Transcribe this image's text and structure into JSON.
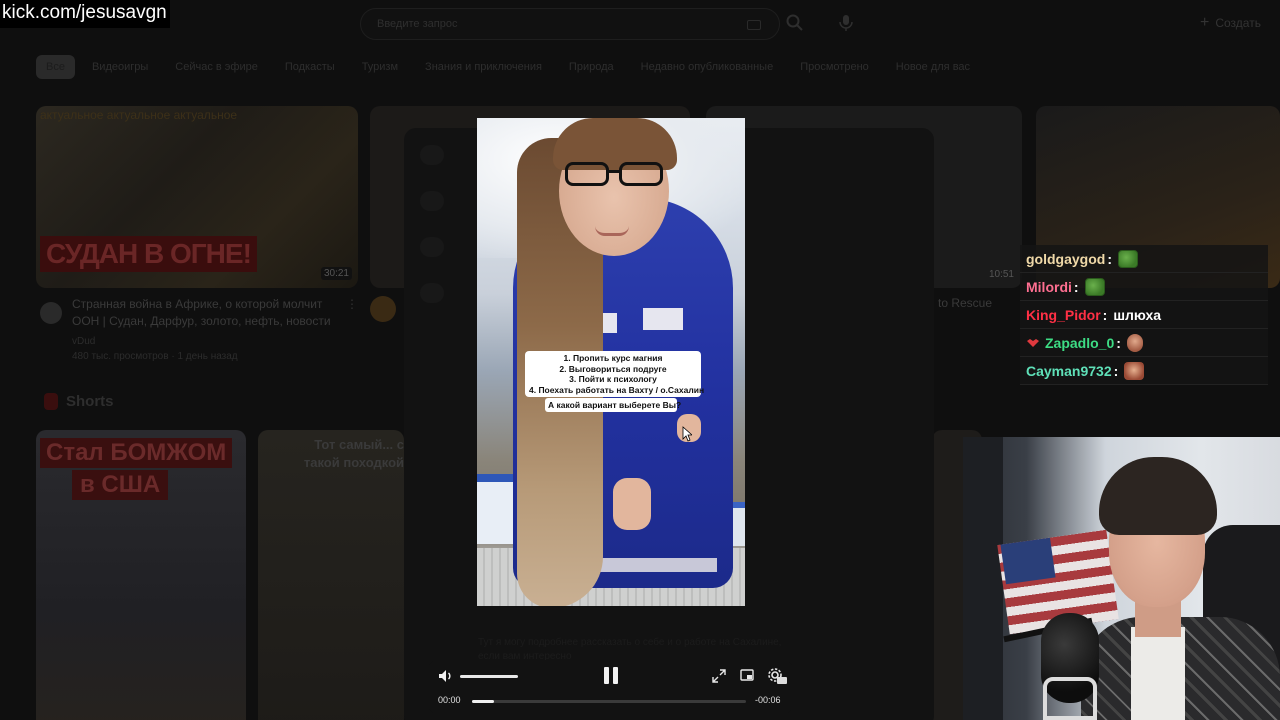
{
  "stream_url": "kick.com/jesusavgn",
  "youtube": {
    "search_placeholder": "Введите запрос",
    "create_label": "Создать",
    "chips": [
      "Все",
      "Видеоигры",
      "Сейчас в эфире",
      "Подкасты",
      "Туризм",
      "Знания и приключения",
      "Природа",
      "Недавно опубликованные",
      "Просмотрено",
      "Новое для вас"
    ],
    "video1": {
      "tag_text": "актуальное актуальное актуальное",
      "banner": "СУДАН В ОГНЕ!",
      "duration": "30:21",
      "title": "Странная война в Африке, о которой молчит ООН | Судан, Дарфур, золото, нефть, новости",
      "channel": "vDud",
      "meta": "480 тыс. просмотров · 1 день назад"
    },
    "video3": {
      "duration": "10:51",
      "title_fragment": "to Rescue"
    },
    "shorts_heading": "Shorts",
    "short1": {
      "line1": "Стал БОМЖОМ",
      "line2": "в США"
    },
    "short2": {
      "title": "Тот самый... с такой походкой"
    }
  },
  "short_video": {
    "overlay_list": [
      "1. Пропить курс магния",
      "2. Выговориться подруге",
      "3. Пойти к психологу",
      "4. Поехать работать на  Вахту / о.Сахалин"
    ],
    "overlay_question": "А какой вариант выберете Вы?",
    "description_ghost": "Тут я могу подробнее рассказать о себе и о работе на Сахалине, если вам интересно"
  },
  "player": {
    "time_current": "00:00",
    "time_remaining": "-00:06",
    "volume_fraction": 1.0,
    "progress_fraction": 0.08
  },
  "chat": [
    {
      "user": "goldgaygod",
      "color": "#f0d9a8",
      "message": "",
      "emote": "frog"
    },
    {
      "user": "Milordi",
      "color": "#ff6f91",
      "message": "",
      "emote": "frog"
    },
    {
      "user": "King_Pidor",
      "color": "#ff3045",
      "message": "шлюха",
      "emote": ""
    },
    {
      "user": "Zapadlo_0",
      "color": "#3ddc84",
      "message": "",
      "emote": "hand",
      "badge": true
    },
    {
      "user": "Cayman9732",
      "color": "#5fe0b8",
      "message": "",
      "emote": "face"
    }
  ]
}
